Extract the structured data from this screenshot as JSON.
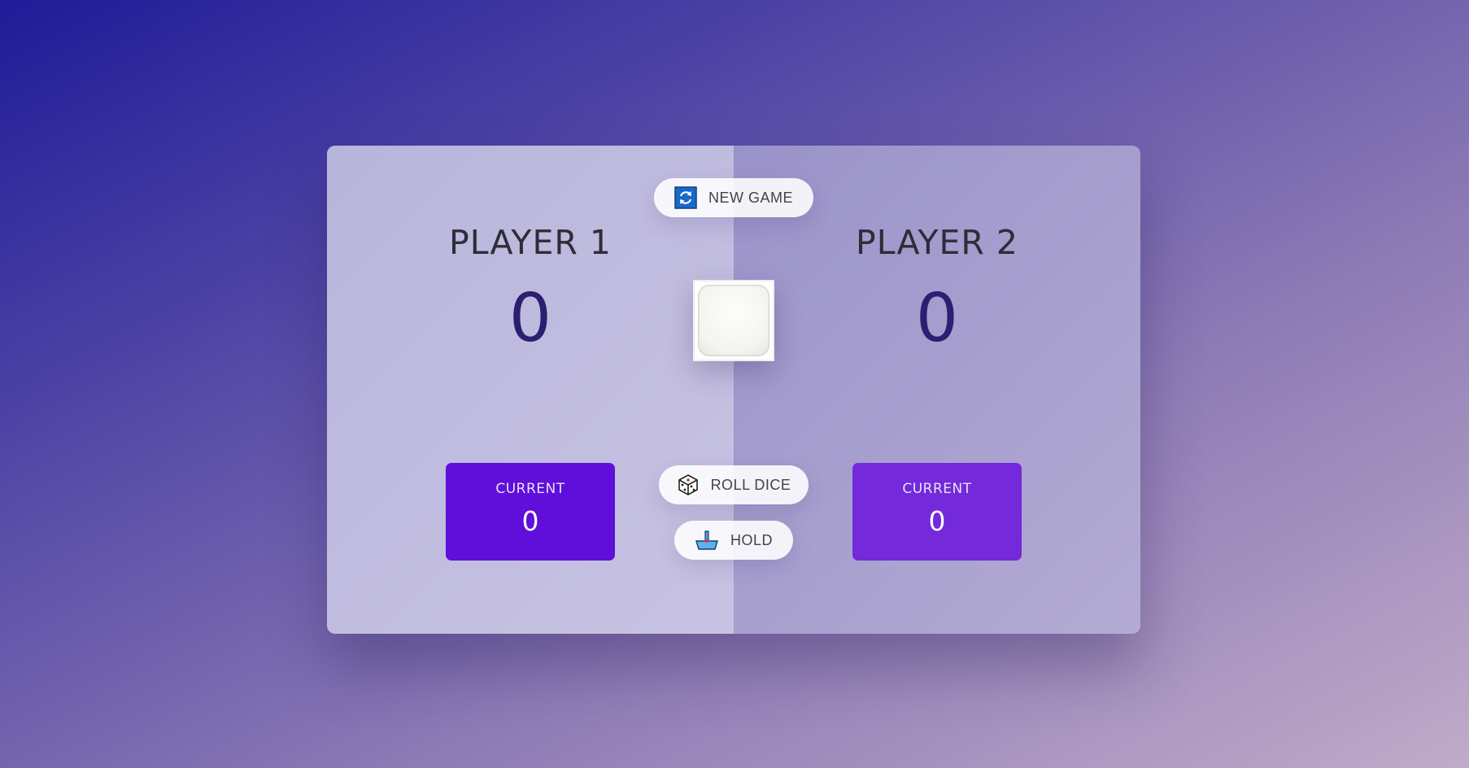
{
  "players": [
    {
      "name": "PLAYER 1",
      "score": "0",
      "current_label": "CURRENT",
      "current_score": "0"
    },
    {
      "name": "PLAYER 2",
      "score": "0",
      "current_label": "CURRENT",
      "current_score": "0"
    }
  ],
  "controls": {
    "new_game": {
      "label": "NEW GAME",
      "icon": "refresh-icon"
    },
    "roll_dice": {
      "label": "ROLL DICE",
      "icon": "dice-icon"
    },
    "hold": {
      "label": "HOLD",
      "icon": "hold-icon"
    }
  },
  "dice": {
    "face": "blank"
  },
  "colors": {
    "player1_current": "#5f0fd9",
    "player2_current": "#7429da",
    "score_text": "#2b1f72"
  }
}
